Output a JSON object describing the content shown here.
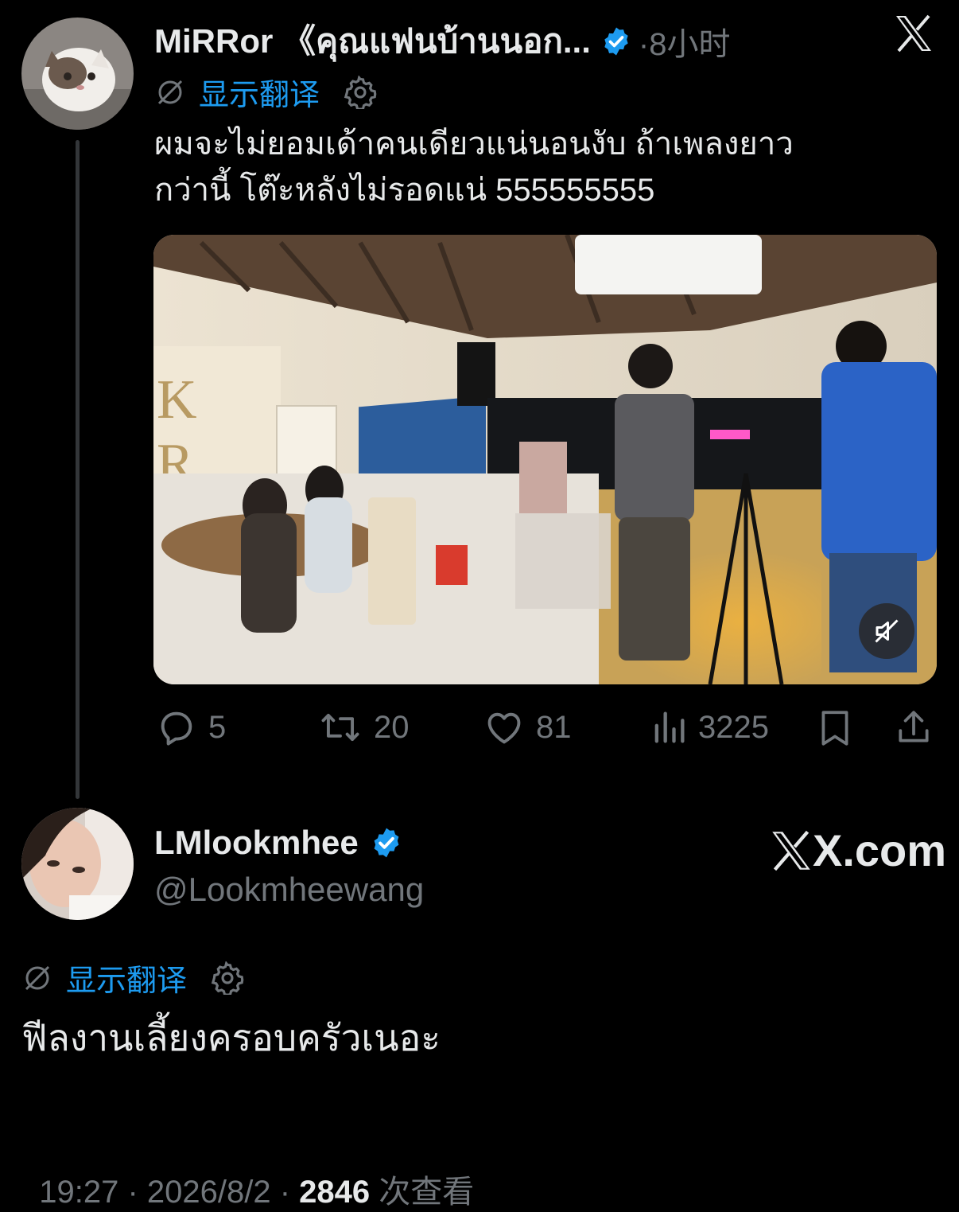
{
  "parent_tweet": {
    "author_name": "MiRRor 《คุณแฟนบ้านนอก...",
    "time": "·8小时",
    "show_translation": "显示翻译",
    "text_line1": "ผมจะไม่ยอมเด้าคนเดียวแน่นอนงับ ถ้าเพลงยาว",
    "text_line2": "กว่านี้ โต๊ะหลังไม่รอดแน่ 555555555",
    "stats": {
      "replies": "5",
      "reposts": "20",
      "likes": "81",
      "views": "3225"
    }
  },
  "reply_tweet": {
    "author_name": "LMlookmhee",
    "handle": "@Lookmheewang",
    "brand": "X.com",
    "show_translation": "显示翻译",
    "text": "ฟีลงานเลี้ยงครอบครัวเนอะ",
    "timestamp": "19:27 · 2026/8/2 · ",
    "view_count": "2846",
    "views_label": " 次查看"
  },
  "colors": {
    "background": "#000000",
    "text": "#e7e9ea",
    "muted": "#71767b",
    "accent": "#1d9bf0"
  },
  "icons": [
    "x-logo-icon",
    "no-translate-icon",
    "gear-icon",
    "verified-badge-icon",
    "reply-icon",
    "repost-icon",
    "like-icon",
    "views-icon",
    "bookmark-icon",
    "share-icon",
    "mute-icon"
  ]
}
